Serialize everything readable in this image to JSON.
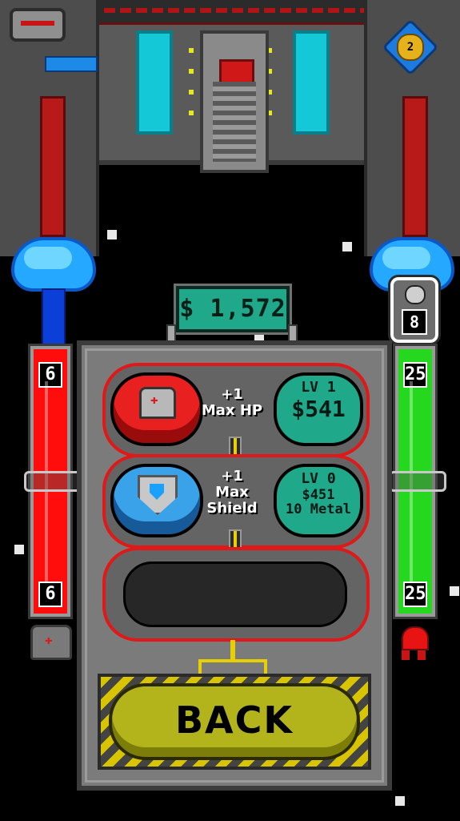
{
  "hud": {
    "money": "$ 1,572",
    "metal_count": "8",
    "level_badge": "2",
    "hp_bar": {
      "top_value": "6",
      "bottom_value": "6",
      "color": "#ff0d0d"
    },
    "shield_bar": {
      "top_value": "25",
      "bottom_value": "25",
      "color": "#25d71e"
    }
  },
  "upgrades": [
    {
      "icon": "hp-icon",
      "desc_line1": "+1",
      "desc_line2": "Max HP",
      "desc_line3": "",
      "level": "LV 1",
      "price": "$541",
      "metal": ""
    },
    {
      "icon": "shield-icon",
      "desc_line1": "+1",
      "desc_line2": "Max",
      "desc_line3": "Shield",
      "level": "LV 0",
      "price": "$451",
      "metal": "10 Metal"
    }
  ],
  "back_label": "BACK",
  "colors": {
    "accent_teal": "#1fa88a",
    "slot_border": "#e01818",
    "back_yellow": "#b3b41c"
  }
}
